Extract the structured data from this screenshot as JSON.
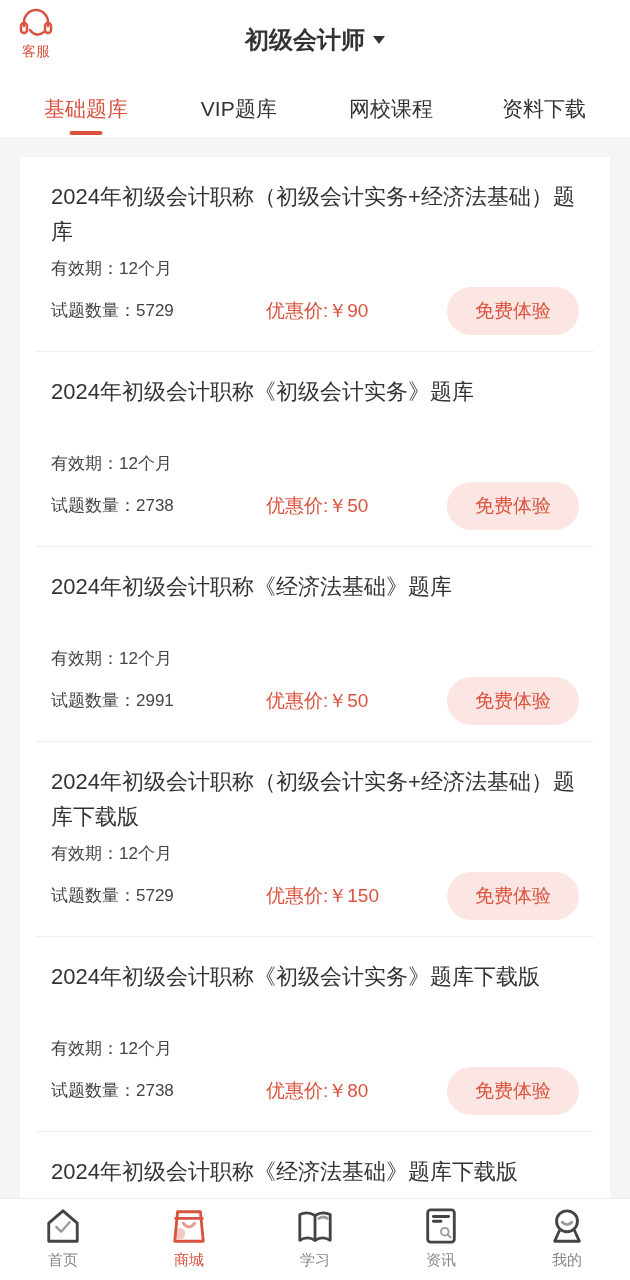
{
  "header": {
    "service_label": "客服",
    "title": "初级会计师"
  },
  "tabs": [
    {
      "label": "基础题库",
      "selected": true
    },
    {
      "label": "VIP题库",
      "selected": false
    },
    {
      "label": "网校课程",
      "selected": false
    },
    {
      "label": "资料下载",
      "selected": false
    }
  ],
  "products": [
    {
      "title": "2024年初级会计职称（初级会计实务+经济法基础）题库",
      "validity": "有效期：12个月",
      "count": "试题数量：5729",
      "price": "优惠价:￥90",
      "button": "免费体验"
    },
    {
      "title": "2024年初级会计职称《初级会计实务》题库",
      "validity": "有效期：12个月",
      "count": "试题数量：2738",
      "price": "优惠价:￥50",
      "button": "免费体验"
    },
    {
      "title": "2024年初级会计职称《经济法基础》题库",
      "validity": "有效期：12个月",
      "count": "试题数量：2991",
      "price": "优惠价:￥50",
      "button": "免费体验"
    },
    {
      "title": "2024年初级会计职称（初级会计实务+经济法基础）题库下载版",
      "validity": "有效期：12个月",
      "count": "试题数量：5729",
      "price": "优惠价:￥150",
      "button": "免费体验"
    },
    {
      "title": "2024年初级会计职称《初级会计实务》题库下载版",
      "validity": "有效期：12个月",
      "count": "试题数量：2738",
      "price": "优惠价:￥80",
      "button": "免费体验"
    },
    {
      "title": "2024年初级会计职称《经济法基础》题库下载版"
    }
  ],
  "bottom_nav": [
    {
      "label": "首页",
      "kind": "home",
      "selected": false
    },
    {
      "label": "商城",
      "kind": "shop",
      "selected": true
    },
    {
      "label": "学习",
      "kind": "book",
      "selected": false
    },
    {
      "label": "资讯",
      "kind": "news",
      "selected": false
    },
    {
      "label": "我的",
      "kind": "profile",
      "selected": false
    }
  ]
}
